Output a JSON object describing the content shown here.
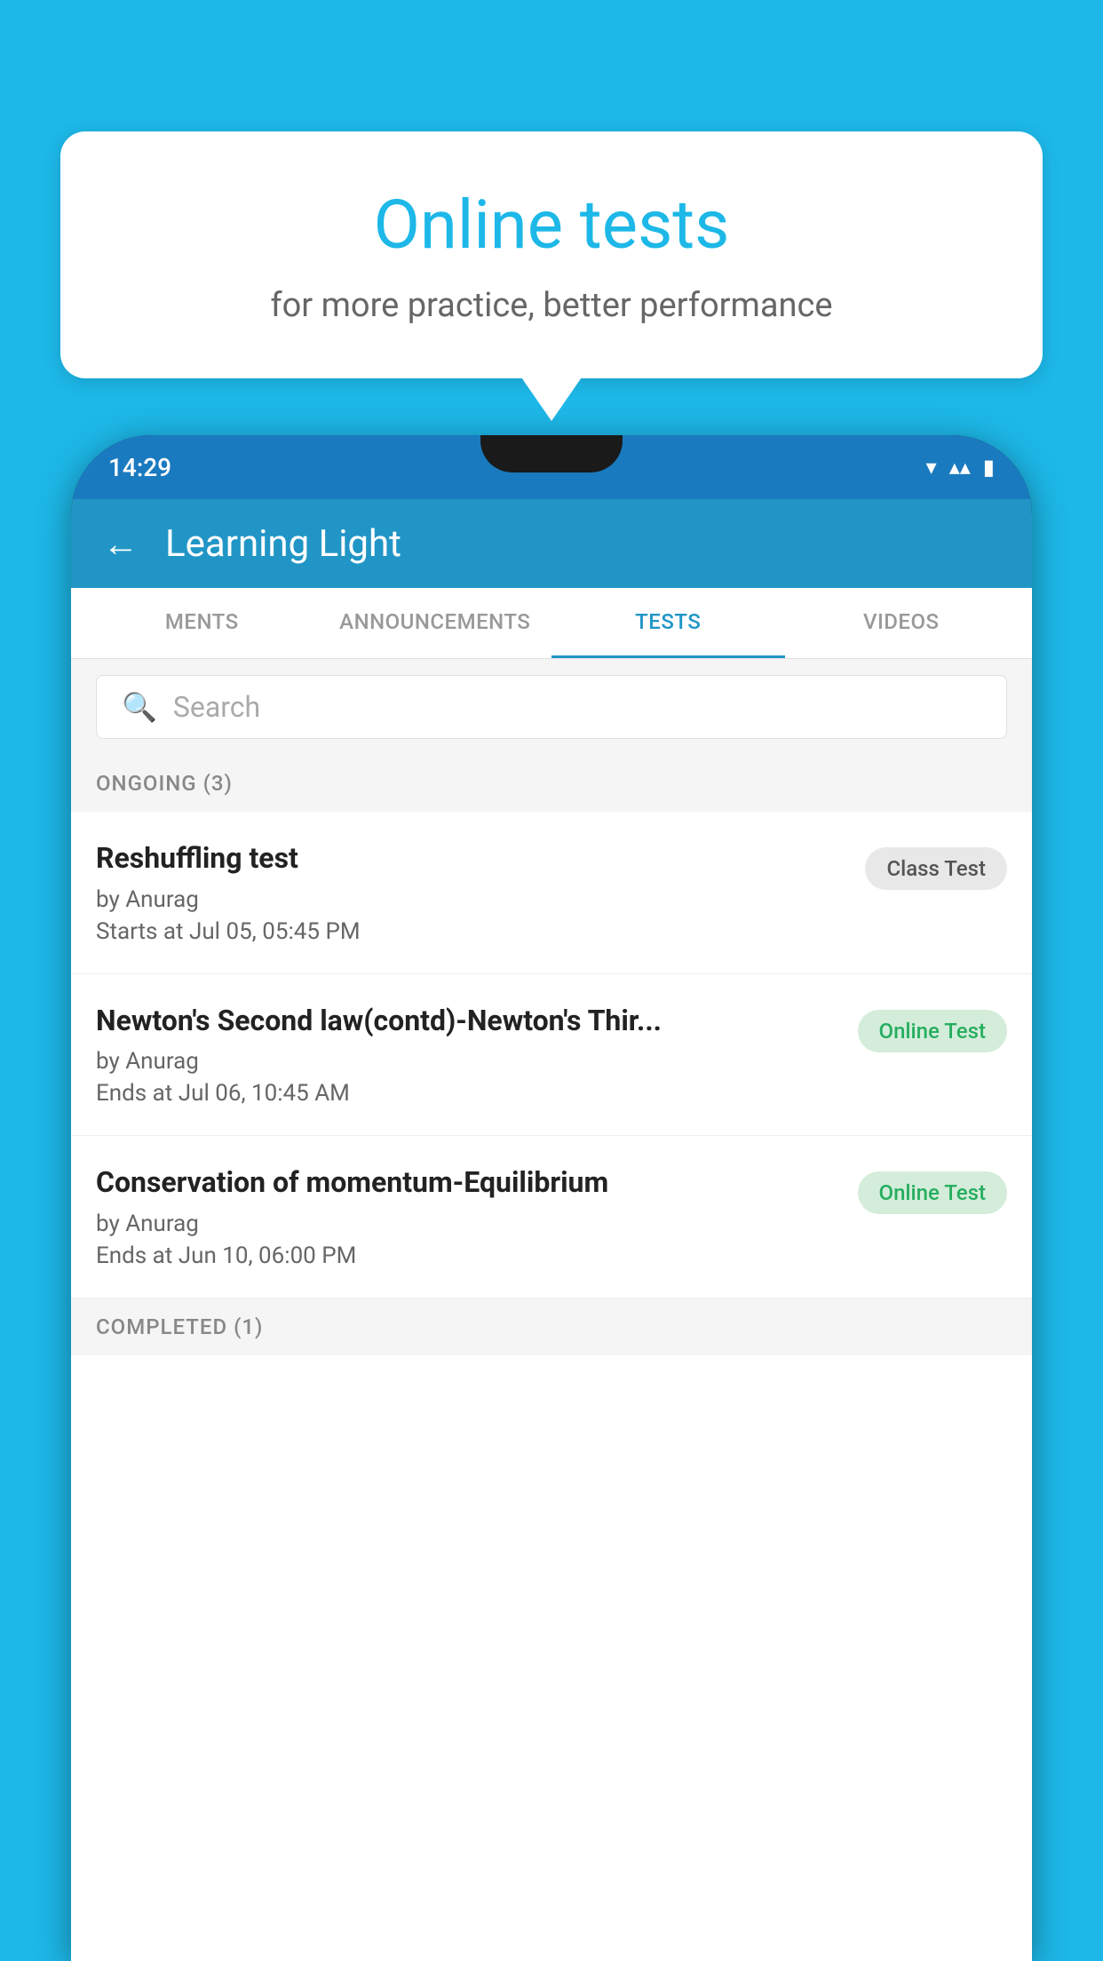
{
  "background_color": "#1DB8E8",
  "bubble": {
    "title": "Online tests",
    "subtitle": "for more practice, better performance"
  },
  "phone": {
    "status_bar": {
      "time": "14:29",
      "icons": [
        "▾▴",
        "▴▴",
        "▮"
      ]
    },
    "header": {
      "title": "Learning Light",
      "back_label": "←"
    },
    "tabs": [
      {
        "label": "MENTS",
        "active": false
      },
      {
        "label": "ANNOUNCEMENTS",
        "active": false
      },
      {
        "label": "TESTS",
        "active": true
      },
      {
        "label": "VIDEOS",
        "active": false
      }
    ],
    "search": {
      "placeholder": "Search"
    },
    "section_ongoing": {
      "label": "ONGOING (3)"
    },
    "tests": [
      {
        "title": "Reshuffling test",
        "by": "by Anurag",
        "date": "Starts at  Jul 05, 05:45 PM",
        "badge": "Class Test",
        "badge_type": "gray"
      },
      {
        "title": "Newton's Second law(contd)-Newton's Thir...",
        "by": "by Anurag",
        "date": "Ends at  Jul 06, 10:45 AM",
        "badge": "Online Test",
        "badge_type": "green"
      },
      {
        "title": "Conservation of momentum-Equilibrium",
        "by": "by Anurag",
        "date": "Ends at  Jun 10, 06:00 PM",
        "badge": "Online Test",
        "badge_type": "green"
      }
    ],
    "section_completed": {
      "label": "COMPLETED (1)"
    }
  }
}
